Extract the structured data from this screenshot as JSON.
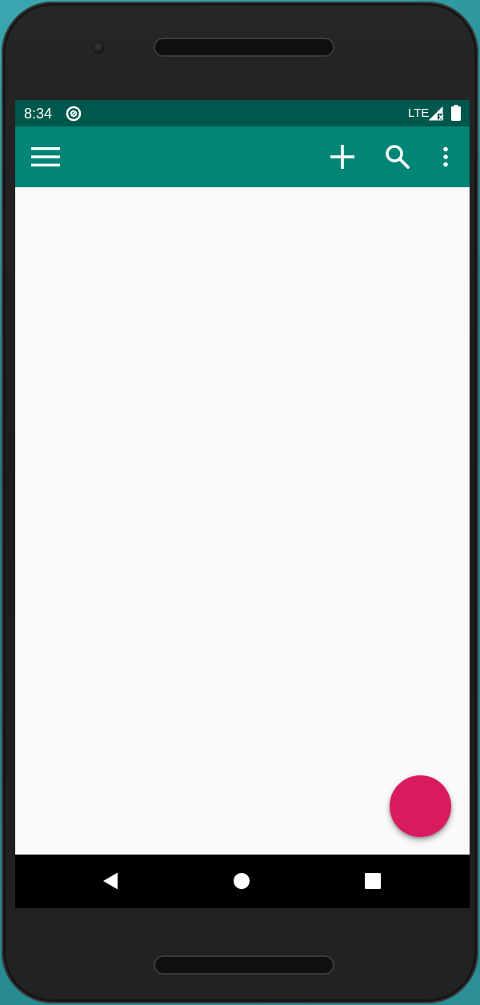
{
  "status_bar": {
    "time": "8:34",
    "network": "LTE",
    "icons": [
      "sync-icon",
      "signal-icon",
      "battery-icon"
    ]
  },
  "app_bar": {
    "color": "#008577",
    "status_color": "#00574b",
    "actions": [
      "menu-icon",
      "add-icon",
      "search-icon",
      "more-vert-icon"
    ]
  },
  "fab": {
    "color": "#d81b60"
  },
  "nav_bar": {
    "buttons": [
      "back-icon",
      "home-icon",
      "recents-icon"
    ]
  }
}
